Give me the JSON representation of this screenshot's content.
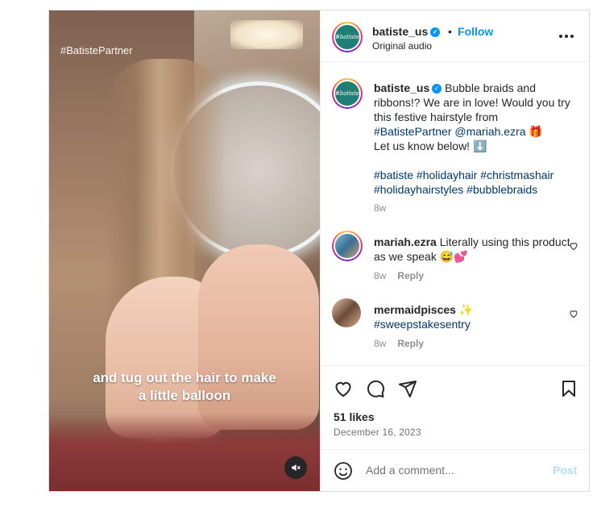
{
  "media": {
    "tag": "#BatistePartner",
    "overlay_line1": "and tug out the hair to make",
    "overlay_line2": "a little balloon",
    "mute_icon": "mute-icon"
  },
  "header": {
    "username": "batiste_us",
    "separator": "•",
    "follow_label": "Follow",
    "audio": "Original audio",
    "avatar_text": "#batiste"
  },
  "caption": {
    "username": "batiste_us",
    "text_1": "Bubble braids and ribbons!? We are in love! Would you try this festive hairstyle from",
    "link_1": "#BatistePartner",
    "link_2": "@mariah.ezra",
    "emoji_1": "🎁",
    "text_2": "Let us know below!",
    "emoji_2": "⬇️",
    "hashtags_1": "#batiste #holidayhair #christmashair",
    "hashtags_2": "#holidayhairstyles #bubblebraids",
    "time": "8w"
  },
  "comments": [
    {
      "username": "mariah.ezra",
      "text": "Literally using this product as we speak",
      "emoji": "😅💕",
      "time": "8w",
      "reply": "Reply"
    },
    {
      "username": "mermaidpisces",
      "emoji": "✨",
      "text": "#sweepstakesentry",
      "time": "8w",
      "reply": "Reply"
    }
  ],
  "actions": {
    "likes": "51 likes",
    "date": "December 16, 2023"
  },
  "add_comment": {
    "placeholder": "Add a comment...",
    "post_label": "Post"
  },
  "colors": {
    "accent": "#0095f6",
    "link": "#00376b",
    "brand_teal": "#1f7f74"
  }
}
